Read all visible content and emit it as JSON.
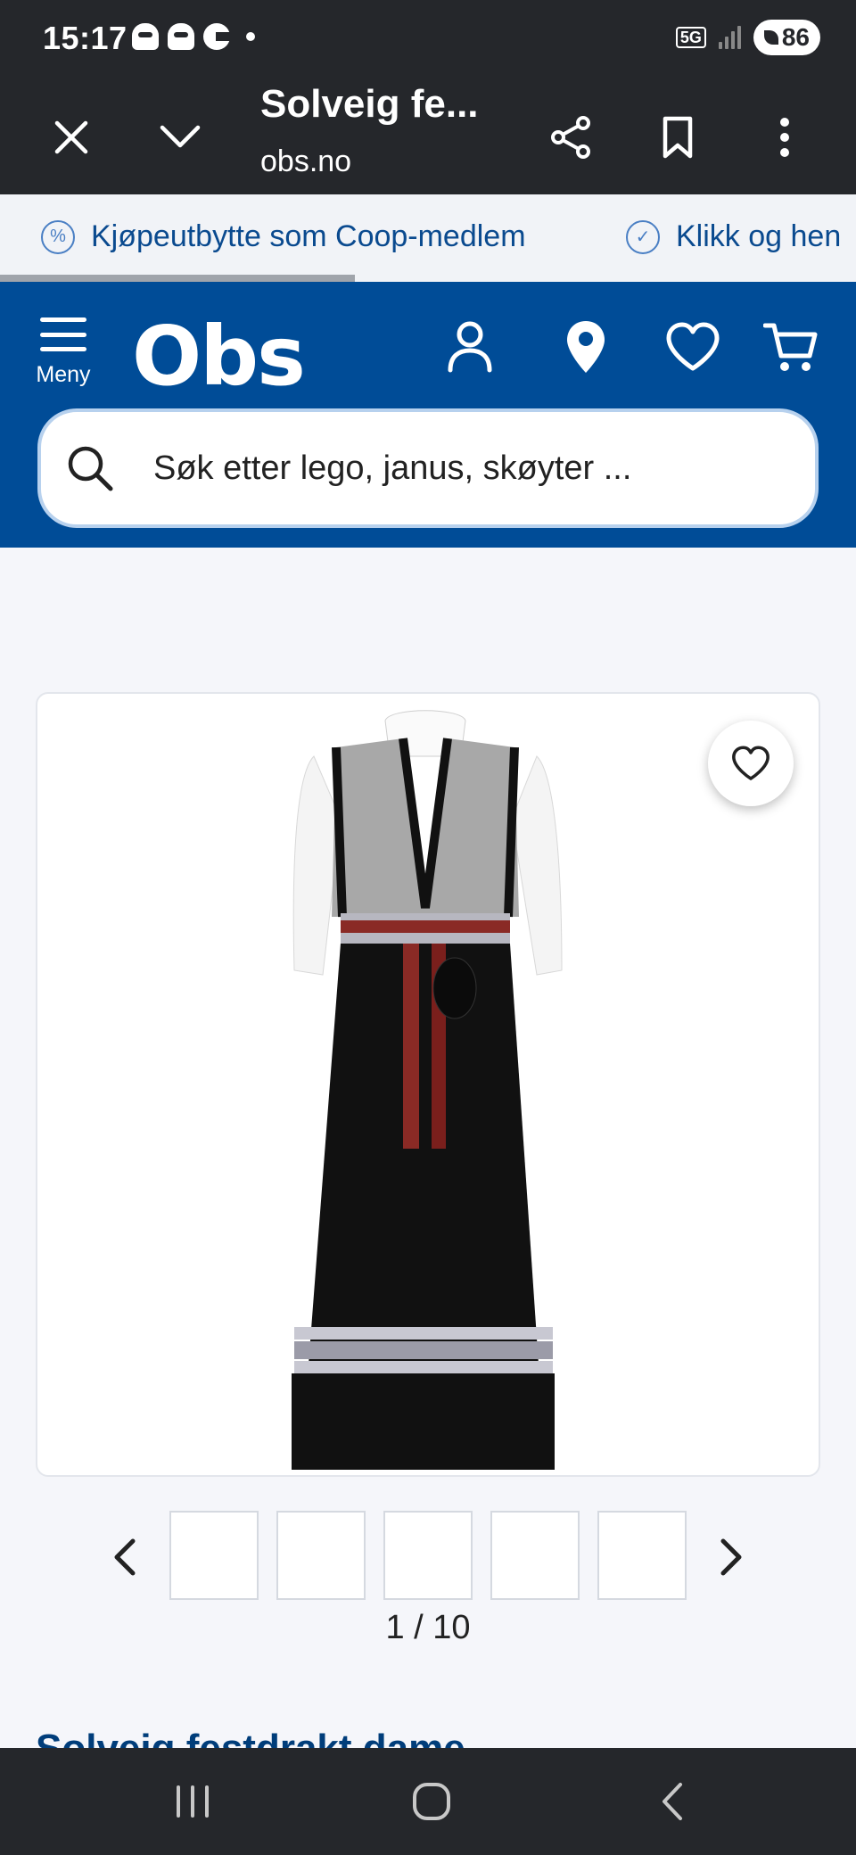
{
  "status_bar": {
    "time": "15:17",
    "network": "5G",
    "battery": "86",
    "icons": [
      "snapchat-icon",
      "snapchat-icon",
      "vpn-icon",
      "notification-dot-icon"
    ]
  },
  "browser": {
    "tab_title": "Solveig fe...",
    "url": "obs.no",
    "icons": [
      "close-icon",
      "chevron-down-icon",
      "share-icon",
      "bookmark-icon",
      "more-vert-icon"
    ]
  },
  "promo": {
    "items": [
      {
        "icon": "percent-icon",
        "text": "Kjøpeutbytte som Coop-medlem"
      },
      {
        "icon": "check-icon",
        "text": "Klikk og hen"
      }
    ]
  },
  "header": {
    "menu_label": "Meny",
    "logo_text": "Obs",
    "icons": [
      "account-icon",
      "location-icon",
      "heart-icon",
      "cart-icon"
    ],
    "search_placeholder": "Søk etter lego, janus, skøyter ..."
  },
  "gallery": {
    "current": 1,
    "total": 10,
    "counter_text": "1 / 10",
    "thumbnail_count": 5,
    "fav_icon": "heart-outline-icon"
  },
  "product": {
    "title": "Solveig festdrakt dame"
  },
  "nav_bar": {
    "buttons": [
      "recent-apps-icon",
      "home-icon",
      "back-icon"
    ]
  },
  "colors": {
    "brand_blue": "#004c97",
    "dark_chrome": "#25272b",
    "promo_text": "#0a4a8f"
  }
}
